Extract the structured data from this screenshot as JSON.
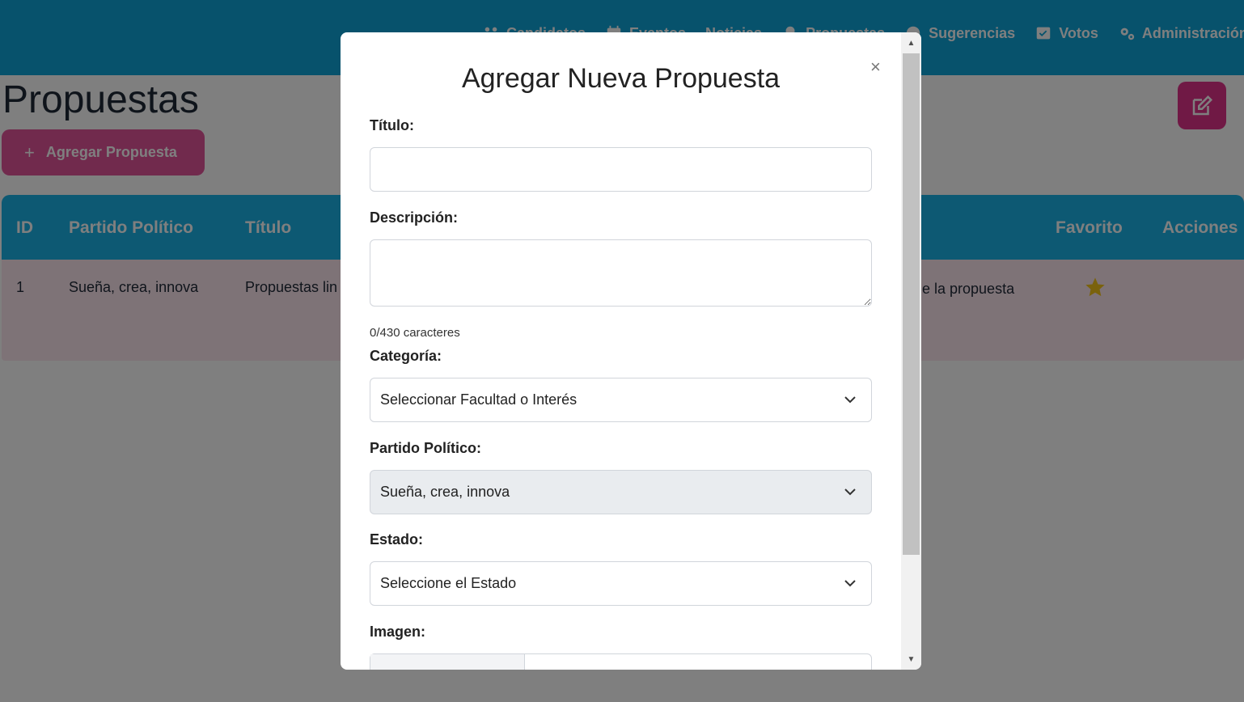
{
  "nav": {
    "items": [
      {
        "label": "Candidatos",
        "icon": "users-icon"
      },
      {
        "label": "Eventos",
        "icon": "calendar-icon"
      },
      {
        "label": "Noticias",
        "icon": "newspaper-icon"
      },
      {
        "label": "Propuestas",
        "icon": "lightbulb-icon"
      },
      {
        "label": "Sugerencias",
        "icon": "comment-icon"
      },
      {
        "label": "Votos",
        "icon": "ballot-icon"
      },
      {
        "label": "Administración",
        "icon": "gears-icon"
      }
    ]
  },
  "page": {
    "title": "Propuestas",
    "add_button": "Agregar Propuesta",
    "add_icon": "+"
  },
  "table": {
    "headers": [
      "ID",
      "Partido Político",
      "Título",
      "Favorito",
      "Acciones"
    ],
    "rows": [
      {
        "id": "1",
        "partido": "Sueña, crea, innova",
        "titulo": "Propuestas lin",
        "descripcion": "le la propuesta",
        "favorito": true
      }
    ]
  },
  "modal": {
    "title": "Agregar Nueva Propuesta",
    "close": "×",
    "titulo_label": "Título:",
    "titulo_value": "",
    "descripcion_label": "Descripción:",
    "descripcion_value": "",
    "counter": "0/430 caracteres",
    "categoria_label": "Categoría:",
    "categoria_value": "Seleccionar Facultad o Interés",
    "partido_label": "Partido Político:",
    "partido_value": "Sueña, crea, innova",
    "estado_label": "Estado:",
    "estado_value": "Seleccione el Estado",
    "imagen_label": "Imagen:"
  },
  "colors": {
    "nav_bg": "#0ea5d8",
    "accent_pink": "#e0338a",
    "table_header": "#1ab2e6",
    "star": "#f5c518"
  }
}
